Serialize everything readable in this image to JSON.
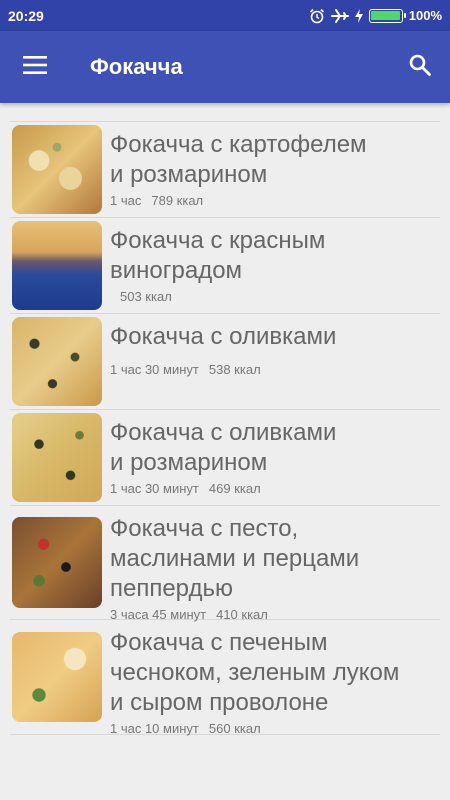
{
  "status_bar": {
    "time": "20:29",
    "battery": "100%",
    "icons": [
      "alarm-icon",
      "airplane-icon",
      "charging-icon",
      "battery-icon"
    ]
  },
  "app_bar": {
    "title": "Фокачча",
    "menu_icon": "menu-icon",
    "search_icon": "search-icon"
  },
  "colors": {
    "primary": "#3f51b5",
    "primary_dark": "#3142a8",
    "background": "#eeeeee",
    "battery_green": "#4cd964"
  },
  "recipes": [
    {
      "title_lines": [
        "Фокачча с картофелем",
        "и розмарином"
      ],
      "time": "1 час",
      "kcal": "789 ккал"
    },
    {
      "title_lines": [
        "Фокачча с красным",
        "виноградом"
      ],
      "time": "",
      "kcal": "503 ккал"
    },
    {
      "title_lines": [
        "Фокачча с оливками"
      ],
      "time": "1 час 30 минут",
      "kcal": "538 ккал"
    },
    {
      "title_lines": [
        "Фокачча с оливками",
        "и розмарином"
      ],
      "time": "1 час 30 минут",
      "kcal": "469 ккал"
    },
    {
      "title_lines": [
        "Фокачча с песто,",
        "маслинами и перцами",
        "пеппердью"
      ],
      "time": "3 часа 45 минут",
      "kcal": "410 ккал"
    },
    {
      "title_lines": [
        "Фокачча с печеным",
        "чесноком, зеленым луком",
        "и сыром проволоне"
      ],
      "time": "1 час 10 минут",
      "kcal": "560 ккал"
    }
  ]
}
